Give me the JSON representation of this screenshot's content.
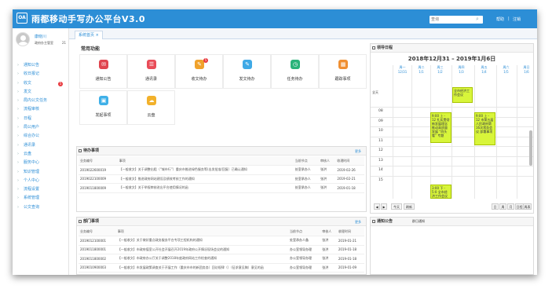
{
  "header": {
    "app_title": "雨都移动手写办公平台V3.0",
    "search_placeholder": "查询",
    "help": "帮助",
    "separator": "|",
    "logout": "注销",
    "logo": "OA"
  },
  "user": {
    "name": "康晓川",
    "dept": "政府办主管室",
    "num": "21"
  },
  "nav": {
    "items": [
      {
        "label": "通知公告"
      },
      {
        "label": "收日报记"
      },
      {
        "label": "收文",
        "badge": "5"
      },
      {
        "label": "发文"
      },
      {
        "label": "局内公文任务"
      },
      {
        "label": "流程审核"
      },
      {
        "label": "日程"
      },
      {
        "label": "局公用户"
      },
      {
        "label": "综合办公"
      },
      {
        "label": "通讯录"
      },
      {
        "label": "云盘"
      },
      {
        "label": "服务中心"
      },
      {
        "label": "知识管理"
      },
      {
        "label": "个人中心"
      },
      {
        "label": "流程设置"
      },
      {
        "label": "系统管理"
      },
      {
        "label": "公文查询"
      }
    ]
  },
  "tabs": {
    "home": "系统首页 ×"
  },
  "common": {
    "title": "常用功能",
    "tiles": [
      {
        "label": "通知公告",
        "icon": "megaphone-icon",
        "glyph": "✉",
        "color": "#e0454f"
      },
      {
        "label": "通讯录",
        "icon": "contacts-icon",
        "glyph": "☰",
        "color": "#e94c58"
      },
      {
        "label": "收文待办",
        "icon": "inbox-icon",
        "glyph": "✎",
        "color": "#f0a22b",
        "badge": "5"
      },
      {
        "label": "发文待办",
        "icon": "send-doc-icon",
        "glyph": "✎",
        "color": "#3fa9e6"
      },
      {
        "label": "任务待办",
        "icon": "task-icon",
        "glyph": "◷",
        "color": "#2ab37a"
      },
      {
        "label": "所有待办",
        "icon": "all-todo-icon",
        "glyph": "▤",
        "color": "#8c6bd6",
        "badge": "5"
      },
      {
        "label": "发起事项",
        "icon": "launch-icon",
        "glyph": "▣",
        "color": "#3fb0e8"
      },
      {
        "label": "云盘",
        "icon": "cloud-disk-icon",
        "glyph": "☁",
        "color": "#f2b12b"
      },
      {
        "label": "跟踪事项",
        "icon": "track-icon",
        "glyph": "▦",
        "color": "#f08f31"
      }
    ]
  },
  "todo": {
    "title": "待办事项",
    "more": "更多",
    "columns": [
      "业务编号",
      "事项",
      "当前节点",
      "审核人",
      "收理时间"
    ],
    "rows": [
      [
        "2019022600019",
        "【一般收文】关于调整出租（“城市行”）重庆市推进绿色服务等(出发批准/回复）已确认通知",
        "处室承办人",
        "张洪",
        "2019-02-26"
      ],
      [
        "2019022100009",
        "【一般收文】推进政府网站建设及绩效考核工作的通知",
        "处室承办人",
        "张洪",
        "2019-02-21"
      ],
      [
        "2019011800009",
        "【一般收文】关于举报审核进出平台使用情况的函",
        "处室承办人",
        "张洪",
        "2019-01-18"
      ]
    ]
  },
  "dept": {
    "title": "部门事项",
    "more": "更多",
    "columns": [
      "业务编号",
      "事项",
      "当前节点",
      "审核人",
      "收理时间"
    ],
    "rows": [
      [
        "2019012100001",
        "【一般收文】关于做好重点政务服务平台专项工程机构的通知",
        "处室承办人备",
        "张洪",
        "2019-01-21"
      ],
      [
        "2019011800001",
        "【一般收文】市政府值室公开社会开展召开2019年政府公开情况现场会议的通知",
        "办公室领导办理",
        "张洪",
        "2019-01-18"
      ],
      [
        "2019011800002",
        "【一般收文】市政府办公厅关于调整2018年度政府网站工作检查的通知",
        "办公室领导办理",
        "张洪",
        "2019-01-18"
      ],
      [
        "2019010900003",
        "【一般收文】市发展政策调查关于开展工作（重庆市市的新团务务）回访规律（）（征求意见稿）意见的函",
        "办公室领导办理",
        "张洪",
        "2019-01-09"
      ]
    ]
  },
  "calendar": {
    "title": "领导日程",
    "range": "2018年12月31 – 2019年1月6日",
    "days": [
      {
        "w": "周一",
        "d": "12/31"
      },
      {
        "w": "周二",
        "d": "1/1"
      },
      {
        "w": "周三",
        "d": "1/2"
      },
      {
        "w": "周四",
        "d": "1/3"
      },
      {
        "w": "周五",
        "d": "1/4"
      },
      {
        "w": "周六",
        "d": "1/5"
      },
      {
        "w": "周日",
        "d": "1/6"
      }
    ],
    "allday": "全天",
    "hours": [
      "08",
      "09",
      "10",
      "11",
      "12",
      "13",
      "14",
      "15"
    ],
    "events": [
      {
        "day": 3,
        "text": "全市经济工作会议"
      },
      {
        "day": 2,
        "text": "9:00 上 - 12 扎实贯彻新发展理念推动高质量发展 “四头看” 专题"
      },
      {
        "day": 4,
        "text": "9:00 上 - 12 市第五届人民政府第16次常务会议 部署事项"
      },
      {
        "day": 2,
        "text": "3:00 下 - 5:0 全市经济工作会议"
      }
    ],
    "prev": "◀",
    "next": "▶",
    "today": "今天",
    "refresh": "刷新",
    "views": [
      "日",
      "周",
      "月",
      "日程",
      "周表"
    ]
  },
  "notice": {
    "title": "通知公告",
    "tab": "群日通知"
  }
}
